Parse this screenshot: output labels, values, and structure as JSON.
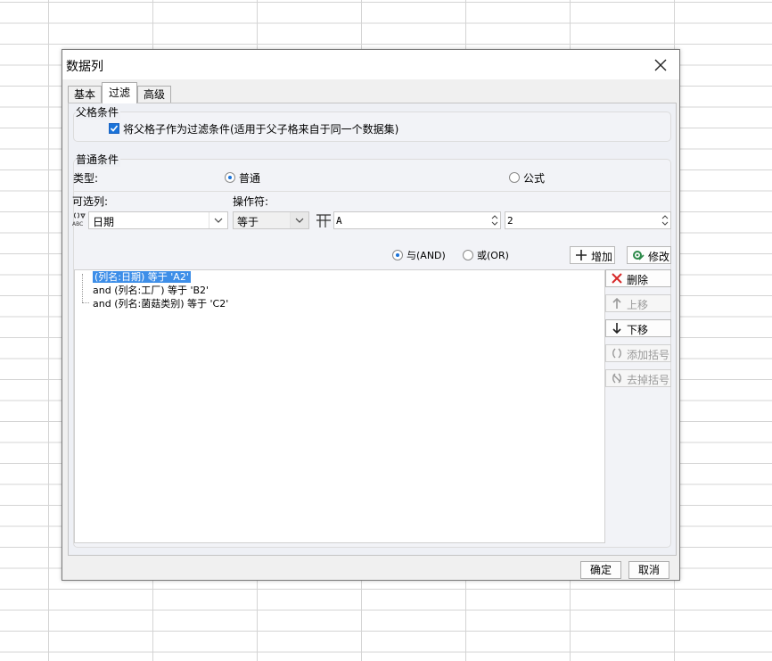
{
  "dialog": {
    "title": "数据列"
  },
  "tabs": [
    {
      "label": "基本"
    },
    {
      "label": "过滤"
    },
    {
      "label": "高级"
    }
  ],
  "parent_condition": {
    "legend": "父格条件",
    "checkbox_label": "将父格子作为过滤条件(适用于父子格来自于同一个数据集)",
    "checked": true
  },
  "normal_condition": {
    "legend": "普通条件",
    "type_label": "类型:",
    "type_options": [
      "普通",
      "公式"
    ],
    "type_selected": "普通",
    "available_columns_label": "可选列:",
    "operator_label": "操作符:",
    "column_value": "日期",
    "operator_value": "等于",
    "value_a": "A",
    "value_b": "2",
    "logic_and": "与(AND)",
    "logic_or": "或(OR)",
    "logic_selected": "与(AND)",
    "add_button": "增加",
    "modify_button": "修改"
  },
  "conditions": [
    {
      "prefix": "",
      "text": "(列名:日期) 等于 'A2'",
      "selected": true
    },
    {
      "prefix": "and",
      "text": "(列名:工厂) 等于 'B2'",
      "selected": false
    },
    {
      "prefix": "and",
      "text": "(列名:菌菇类别) 等于 'C2'",
      "selected": false
    }
  ],
  "side_buttons": {
    "delete": "删除",
    "move_up": "上移",
    "move_down": "下移",
    "add_bracket": "添加括号",
    "remove_bracket": "去掉括号"
  },
  "footer": {
    "ok": "确定",
    "cancel": "取消"
  },
  "colors": {
    "accent": "#1a73d9",
    "selection": "#3d8ee8"
  }
}
